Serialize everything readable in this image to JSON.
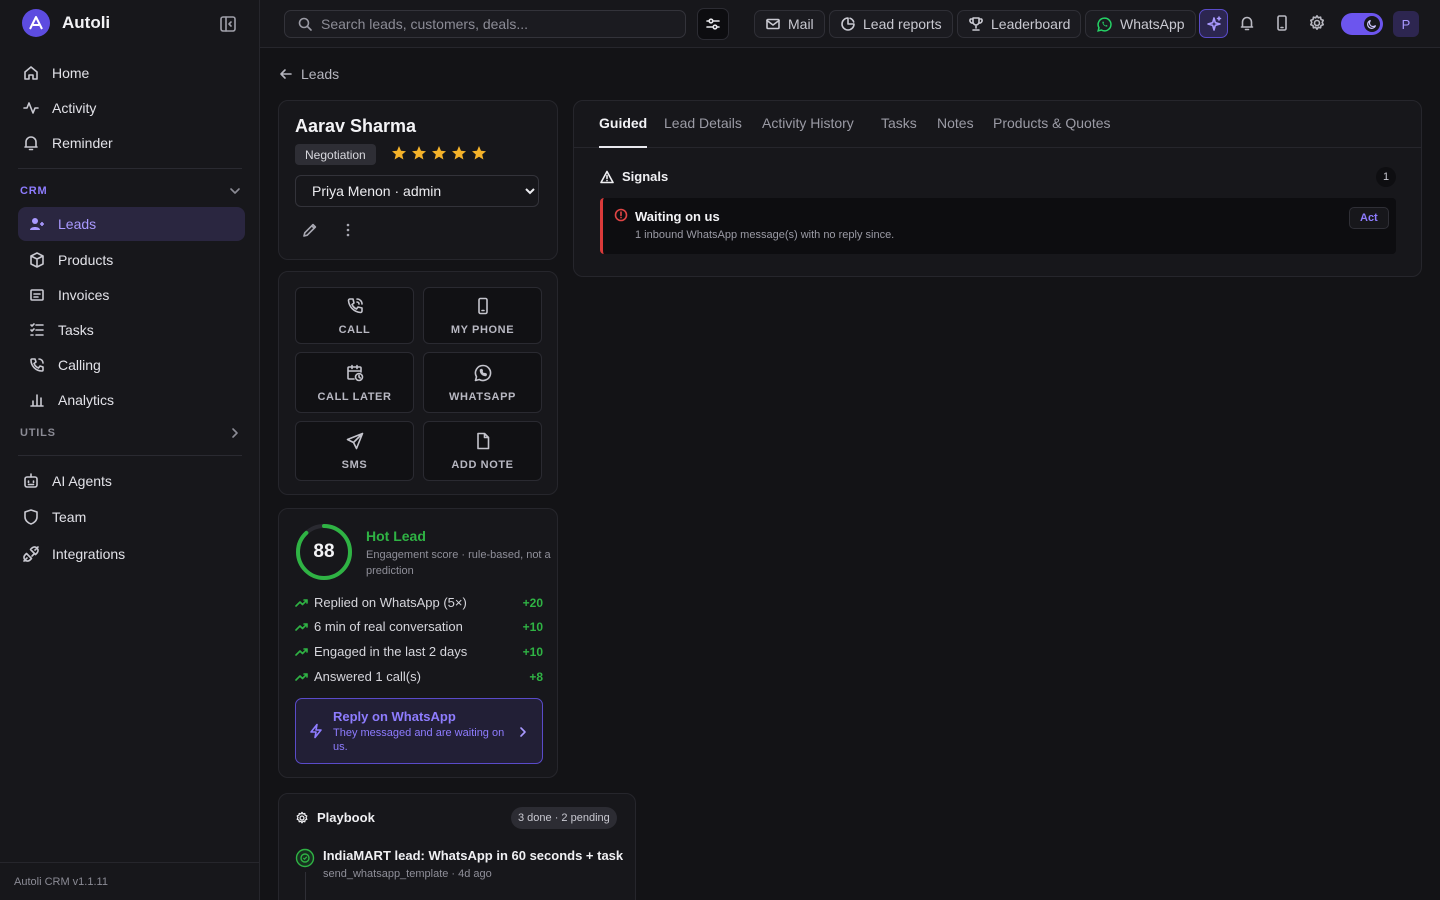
{
  "brand": {
    "name": "Autoli"
  },
  "sidebar": {
    "items_top": [
      {
        "label": "Home",
        "icon": "home-icon"
      },
      {
        "label": "Activity",
        "icon": "activity-icon"
      },
      {
        "label": "Reminder",
        "icon": "bell-icon"
      }
    ],
    "crm_label": "CRM",
    "crm_items": [
      {
        "label": "Leads",
        "icon": "user-plus-icon",
        "active": true
      },
      {
        "label": "Products",
        "icon": "box-icon"
      },
      {
        "label": "Invoices",
        "icon": "invoice-icon"
      },
      {
        "label": "Tasks",
        "icon": "list-check-icon"
      },
      {
        "label": "Calling",
        "icon": "phone-icon"
      },
      {
        "label": "Analytics",
        "icon": "bar-chart-icon"
      }
    ],
    "utils_label": "UTILS",
    "items_bottom": [
      {
        "label": "AI Agents",
        "icon": "robot-icon"
      },
      {
        "label": "Team",
        "icon": "shield-icon"
      },
      {
        "label": "Integrations",
        "icon": "plug-icon"
      }
    ],
    "version": "Autoli CRM v1.1.11"
  },
  "topbar": {
    "search_placeholder": "Search leads, customers, deals...",
    "mail": "Mail",
    "lead_reports": "Lead reports",
    "leaderboard": "Leaderboard",
    "whatsapp": "WhatsApp",
    "avatar_initial": "P",
    "accent_color": "#6c55ee"
  },
  "breadcrumb": {
    "back_label": "Leads"
  },
  "lead": {
    "name": "Aarav Sharma",
    "stage": "Negotiation",
    "rating": 5,
    "owner": "Priya Menon · admin"
  },
  "actions": [
    {
      "label": "CALL",
      "icon": "phone-call-icon"
    },
    {
      "label": "MY PHONE",
      "icon": "smartphone-icon"
    },
    {
      "label": "CALL LATER",
      "icon": "calendar-clock-icon"
    },
    {
      "label": "WHATSAPP",
      "icon": "whatsapp-icon"
    },
    {
      "label": "SMS",
      "icon": "send-icon"
    },
    {
      "label": "ADD NOTE",
      "icon": "file-icon"
    }
  ],
  "score": {
    "value": 88,
    "max": 100,
    "title": "Hot Lead",
    "subtitle": "Engagement score · rule-based, not a prediction",
    "factors": [
      {
        "label": "Replied on WhatsApp (5×)",
        "points": "+20"
      },
      {
        "label": "6 min of real conversation",
        "points": "+10"
      },
      {
        "label": "Engaged in the last 2 days",
        "points": "+10"
      },
      {
        "label": "Answered 1 call(s)",
        "points": "+8"
      }
    ],
    "cta_title": "Reply on WhatsApp",
    "cta_subtitle": "They messaged and are waiting on us."
  },
  "playbook": {
    "title": "Playbook",
    "count": "3 done · 2 pending",
    "steps": [
      {
        "title": "IndiaMART lead: WhatsApp in 60 seconds + task",
        "subtitle": "send_whatsapp_template · 4d ago"
      }
    ]
  },
  "tabs": [
    "Guided",
    "Lead Details",
    "Activity History",
    "Tasks",
    "Notes",
    "Products & Quotes"
  ],
  "signals": {
    "title": "Signals",
    "count": "1",
    "items": [
      {
        "title": "Waiting on us",
        "subtitle": "1 inbound WhatsApp message(s) with no reply since.",
        "action": "Act",
        "color": "#d93a3a"
      }
    ]
  }
}
